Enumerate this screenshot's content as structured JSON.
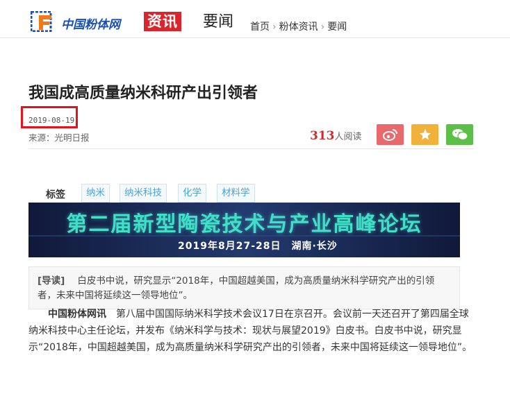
{
  "header": {
    "logo_text": "中国粉体网",
    "badge": "资讯",
    "section": "要闻",
    "breadcrumb": [
      "首页",
      "粉体资讯",
      "要闻"
    ]
  },
  "article": {
    "title": "我国成高质量纳米科研产出引领者",
    "date": "2019-08-19",
    "source": "来源：光明日报",
    "read_count": "313",
    "read_label": "人阅读",
    "tags_label": "标签",
    "tags": [
      "纳米",
      "纳米科技",
      "化学",
      "材料学"
    ],
    "lead_label": "[导读]",
    "lead_text": "白皮书中说，研究显示“2018年，中国超越美国，成为高质量纳米科学研究产出的引领者，未来中国将延续这一领导地位”。",
    "body_source": "中国粉体网讯",
    "body_text": "第八届中国国际纳米科学技术会议17日在京召开。会议前一天还召开了第四届全球纳米科技中心主任论坛，并发布《纳米科学与技术：现状与展望2019》白皮书。白皮书中说，研究显示“2018年，中国超越美国，成为高质量纳米科学研究产出的引领者，未来中国将延续这一领导地位”。"
  },
  "banner": {
    "title": "第二届新型陶瓷技术与产业高峰论坛",
    "subtitle": "2019年8月27-28日　湖南·长沙"
  },
  "colors": {
    "accent_red": "#d8262c",
    "brand_blue": "#1b4fb0",
    "weibo": "#e86a6d",
    "favorite": "#f0b23a",
    "wechat": "#5bbf4a",
    "tag_text": "#4aa3d6"
  },
  "icons": [
    "logo-mark-icon",
    "weibo-icon",
    "star-icon",
    "wechat-icon"
  ]
}
